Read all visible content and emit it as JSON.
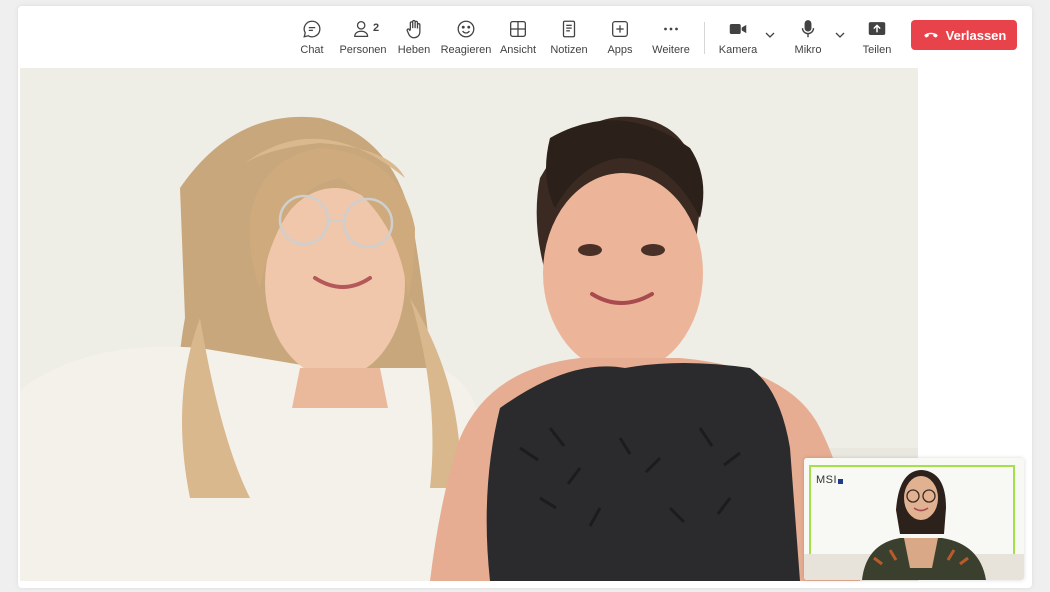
{
  "toolbar": {
    "chat": "Chat",
    "people": "Personen",
    "people_count": "2",
    "raise_hand": "Heben",
    "react": "Reagieren",
    "view": "Ansicht",
    "notes": "Notizen",
    "apps": "Apps",
    "more": "Weitere",
    "camera": "Kamera",
    "mic": "Mikro",
    "share": "Teilen",
    "leave": "Verlassen"
  },
  "self_view": {
    "logo_text": "MSI"
  },
  "colors": {
    "leave_button": "#e8434a",
    "self_view_border": "#a4e04a",
    "icon": "#424242"
  }
}
